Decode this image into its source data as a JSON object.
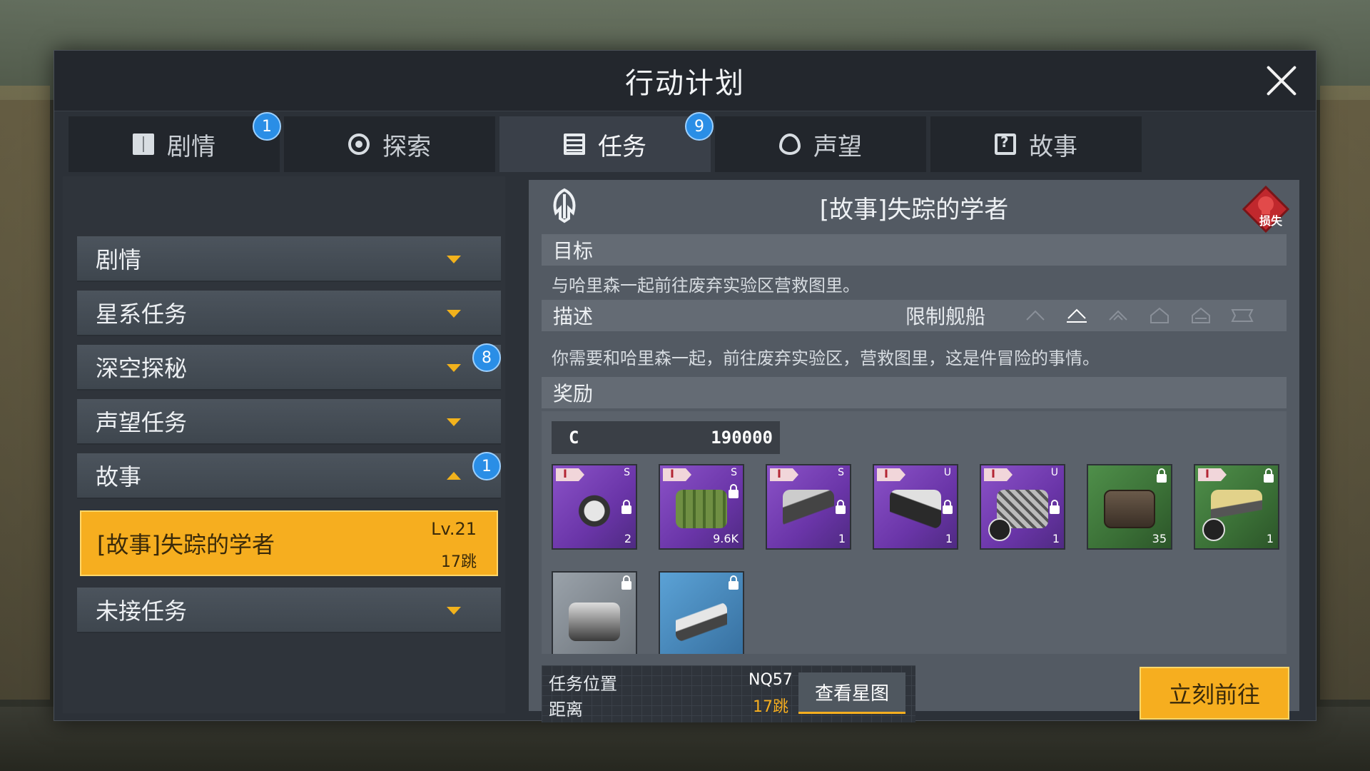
{
  "dialog": {
    "title": "行动计划"
  },
  "tabs": [
    {
      "label": "剧情",
      "icon": "book-icon",
      "badge": "1"
    },
    {
      "label": "探索",
      "icon": "explore-icon",
      "badge": ""
    },
    {
      "label": "任务",
      "icon": "task-icon",
      "badge": "9",
      "active": true
    },
    {
      "label": "声望",
      "icon": "reputation-icon",
      "badge": ""
    },
    {
      "label": "故事",
      "icon": "story-icon",
      "badge": ""
    }
  ],
  "sidebar": {
    "categories": [
      {
        "label": "剧情",
        "expanded": false,
        "badge": ""
      },
      {
        "label": "星系任务",
        "expanded": false,
        "badge": ""
      },
      {
        "label": "深空探秘",
        "expanded": false,
        "badge": "8"
      },
      {
        "label": "声望任务",
        "expanded": false,
        "badge": ""
      },
      {
        "label": "故事",
        "expanded": true,
        "badge": "1"
      },
      {
        "label": "未接任务",
        "expanded": false,
        "badge": ""
      }
    ],
    "selected_quest": {
      "title": "[故事]失踪的学者",
      "level": "Lv.21",
      "jumps": "17跳"
    }
  },
  "detail": {
    "title": "[故事]失踪的学者",
    "loss_label": "损失",
    "objective_header": "目标",
    "objective_text": "与哈里森一起前往废弃实验区营救图里。",
    "description_header": "描述",
    "restrict_label": "限制舰船",
    "description_text": "你需要和哈里森一起，前往废弃实验区，营救图里，这是件冒险的事情。",
    "rewards_header": "奖励",
    "credits": {
      "symbol": "C",
      "amount": "190000"
    },
    "rewards": [
      {
        "color": "purple",
        "grade": "S",
        "count": "2"
      },
      {
        "color": "purple",
        "grade": "S",
        "count": "9.6K"
      },
      {
        "color": "purple",
        "grade": "S",
        "count": "1"
      },
      {
        "color": "purple",
        "grade": "U",
        "count": "1"
      },
      {
        "color": "purple",
        "grade": "U",
        "count": "1"
      },
      {
        "color": "green",
        "grade": "",
        "count": "35"
      },
      {
        "color": "green",
        "grade": "",
        "count": "1"
      },
      {
        "color": "grey",
        "grade": "",
        "count": ""
      },
      {
        "color": "blue",
        "grade": "",
        "count": ""
      }
    ],
    "location": {
      "label": "任务位置",
      "value": "NQ57",
      "distance_label": "距离",
      "distance_value": "17跳",
      "star_map_button": "查看星图"
    },
    "go_button": "立刻前往"
  },
  "colors": {
    "accent": "#f6ae1f",
    "badge": "#2a8ee6",
    "panel": "#535a63",
    "purple": "#7a44b8",
    "green": "#3f7a3b"
  }
}
